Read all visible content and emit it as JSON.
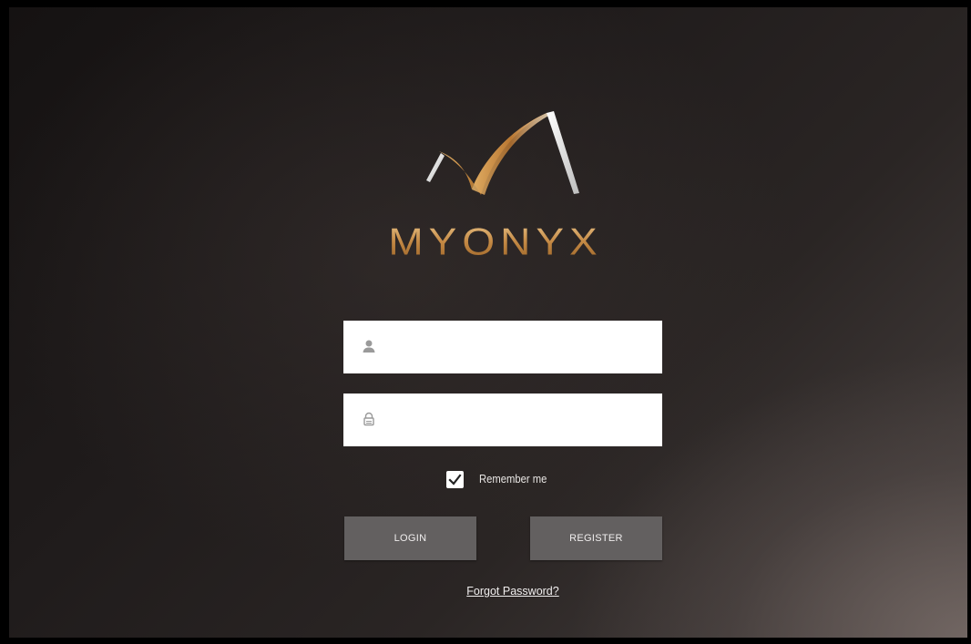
{
  "brand": {
    "name": "MYONYX",
    "gold_color": "#c58a45"
  },
  "login_form": {
    "username": {
      "value": "",
      "placeholder": "",
      "icon": "user-icon"
    },
    "password": {
      "value": "",
      "placeholder": "",
      "icon": "lock-icon"
    },
    "remember_me": {
      "label": "Remember me",
      "checked": true
    },
    "login_label": "LOGIN",
    "register_label": "REGISTER",
    "forgot_password_label": "Forgot Password?"
  },
  "colors": {
    "button_bg": "#636060",
    "field_bg": "#ffffff",
    "text_light": "#f0eeee"
  }
}
